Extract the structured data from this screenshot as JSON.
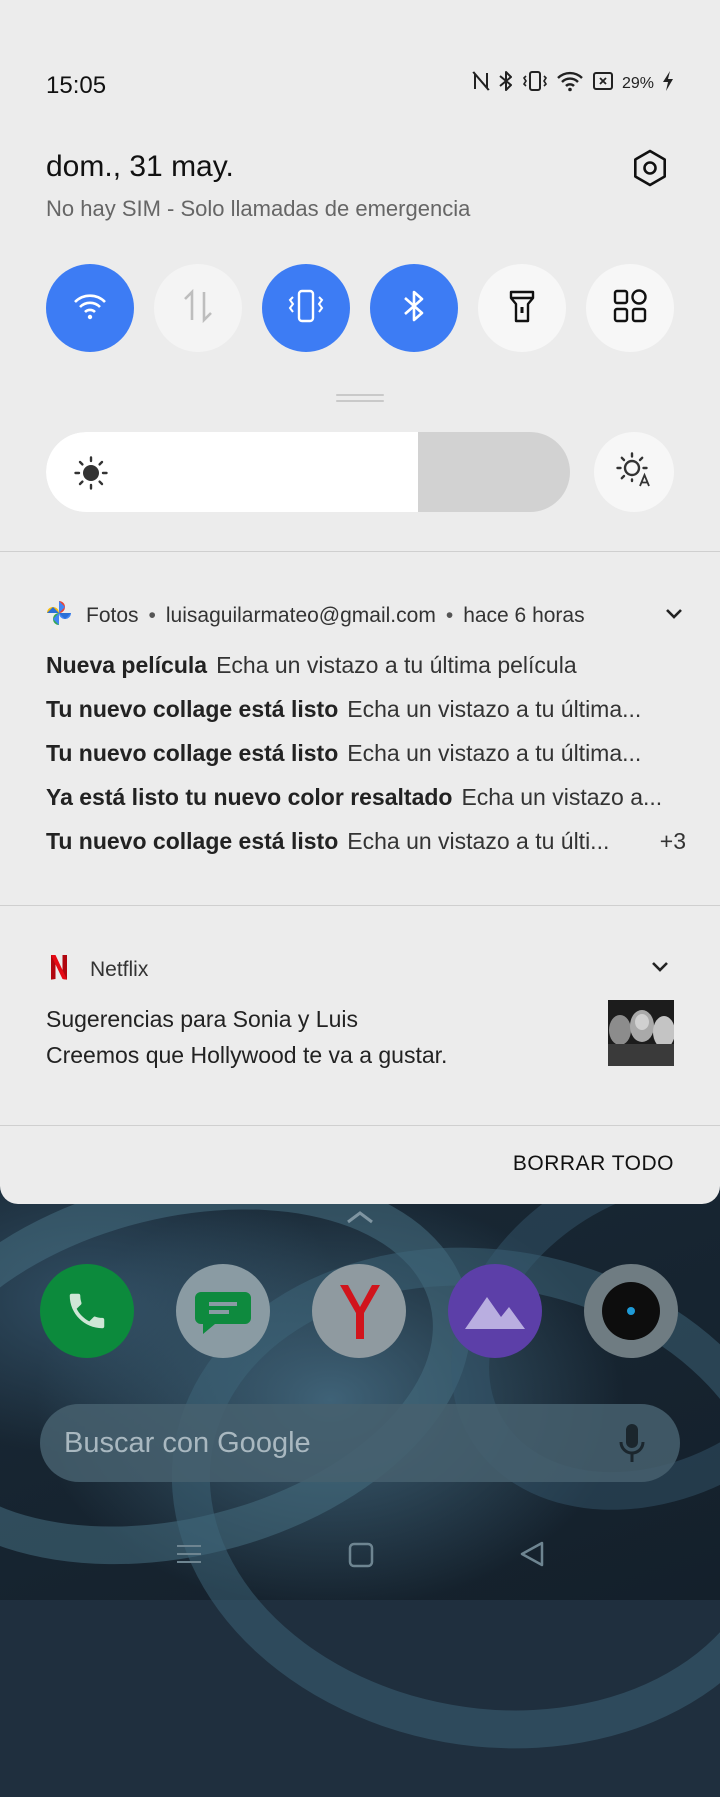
{
  "status_bar": {
    "time": "15:05",
    "battery_percent": "29%",
    "icons": [
      "nfc-icon",
      "bluetooth-icon",
      "vibrate-icon",
      "wifi-icon",
      "no-sim-icon",
      "battery-charging-icon"
    ]
  },
  "header": {
    "date": "dom., 31 may.",
    "sim_status": "No hay SIM - Solo llamadas de emergencia",
    "settings_icon": "settings-icon"
  },
  "quick_tiles": [
    {
      "name": "wifi",
      "icon": "wifi-icon",
      "active": true
    },
    {
      "name": "mobile-data",
      "icon": "data-arrows-icon",
      "active": false
    },
    {
      "name": "vibrate",
      "icon": "vibrate-icon",
      "active": true
    },
    {
      "name": "bluetooth",
      "icon": "bluetooth-icon",
      "active": true
    },
    {
      "name": "flashlight",
      "icon": "flashlight-icon",
      "active": false
    },
    {
      "name": "more-tiles",
      "icon": "grid-icon",
      "active": false
    }
  ],
  "brightness": {
    "level": 0.71,
    "icon": "sun-icon",
    "auto_icon": "auto-brightness-icon"
  },
  "colors": {
    "accent": "#3d7cf4",
    "shade_bg": "#ececec",
    "netflix_red": "#e50914",
    "photos_blue": "#4285f4"
  },
  "notifications": {
    "photos": {
      "app": "Fotos",
      "account": "luisaguilarmateo@gmail.com",
      "time": "hace 6 horas",
      "items": [
        {
          "title": "Nueva película",
          "body": "Echa un vistazo a tu última película"
        },
        {
          "title": "Tu nuevo collage está listo",
          "body": "Echa un vistazo a tu última..."
        },
        {
          "title": "Tu nuevo collage está listo",
          "body": "Echa un vistazo a tu última..."
        },
        {
          "title": "Ya está listo tu nuevo color resaltado",
          "body": "Echa un vistazo a..."
        },
        {
          "title": "Tu nuevo collage está listo",
          "body": "Echa un vistazo a tu últi...",
          "more": "+3"
        }
      ]
    },
    "netflix": {
      "app": "Netflix",
      "title": "Sugerencias para Sonia y Luis",
      "body": "Creemos que Hollywood te va a gustar."
    },
    "clear_all": "BORRAR TODO"
  },
  "home_screen": {
    "dock_apps": [
      "phone-icon",
      "messages-icon",
      "yandex-browser-icon",
      "gallery-icon",
      "camera-icon"
    ],
    "search_placeholder": "Buscar con Google"
  }
}
